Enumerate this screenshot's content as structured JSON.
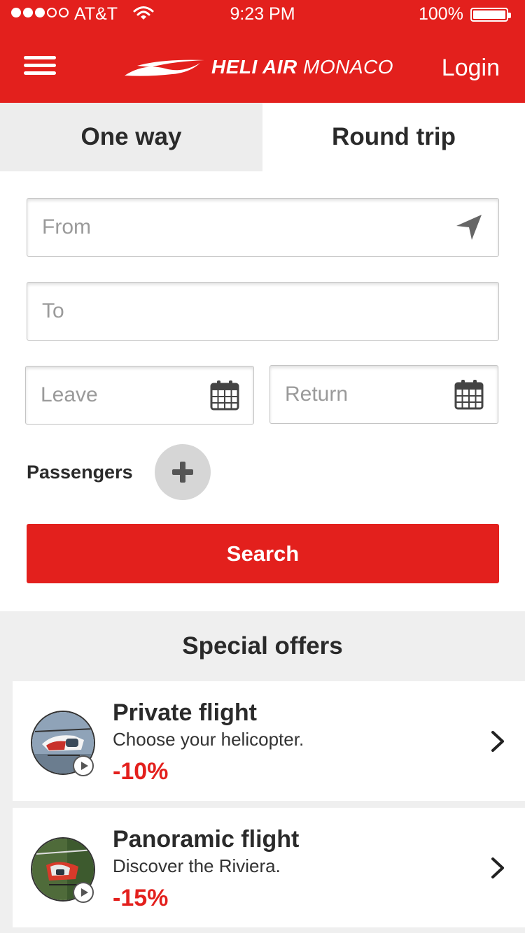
{
  "status_bar": {
    "carrier": "AT&T",
    "time": "9:23 PM",
    "battery": "100%",
    "signal_bars_filled": 3,
    "signal_bars_total": 5
  },
  "header": {
    "brand_bold": "HELI AIR",
    "brand_light": "MONACO",
    "login_label": "Login",
    "accent_color": "#e3201d"
  },
  "tabs": [
    {
      "label": "One way",
      "active": false
    },
    {
      "label": "Round trip",
      "active": true
    }
  ],
  "form": {
    "from_placeholder": "From",
    "to_placeholder": "To",
    "leave_placeholder": "Leave",
    "return_placeholder": "Return",
    "passengers_label": "Passengers",
    "search_label": "Search"
  },
  "offers": {
    "title": "Special offers",
    "items": [
      {
        "title": "Private flight",
        "subtitle": "Choose your helicopter.",
        "discount": "-10%"
      },
      {
        "title": "Panoramic flight",
        "subtitle": "Discover the Riviera.",
        "discount": "-15%"
      }
    ]
  },
  "icons": {
    "menu": "hamburger-menu-icon",
    "location": "location-arrow-icon",
    "calendar": "calendar-icon",
    "add": "plus-icon",
    "chevron": "chevron-right-icon",
    "play": "play-icon"
  }
}
